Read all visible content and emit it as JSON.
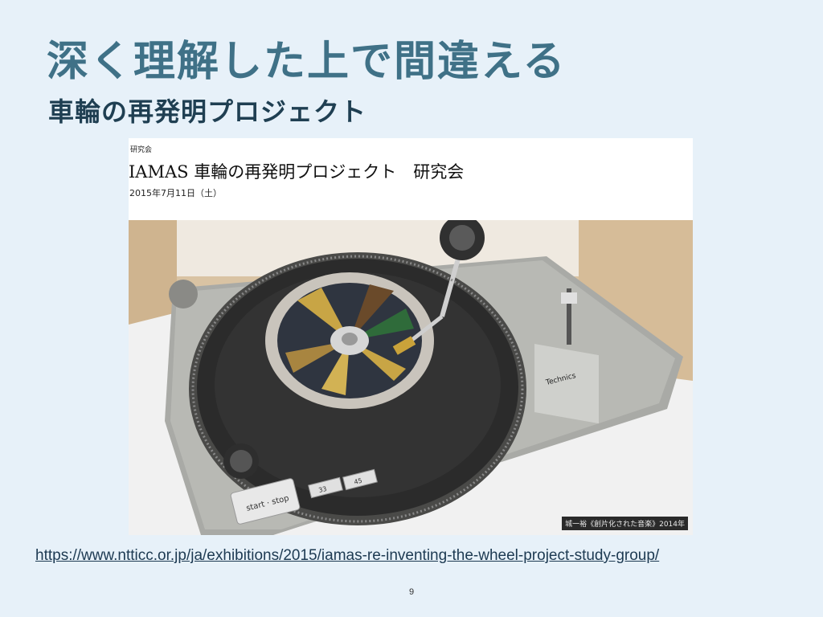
{
  "slide": {
    "title": "深く理解した上で間違える",
    "subtitle": "車輪の再発明プロジェクト",
    "url": "https://www.ntticc.or.jp/ja/exhibitions/2015/iamas-re-inventing-the-wheel-project-study-group/",
    "page_number": "9"
  },
  "card": {
    "category": "研究会",
    "title": "IAMAS 車輪の再発明プロジェクト　研究会",
    "date": "2015年7月11日（土）"
  },
  "photo": {
    "brand": "Technics",
    "start_stop_label": "start · stop",
    "speed_33": "33",
    "speed_45": "45",
    "caption": "城一裕《創片化された音楽》2014年"
  }
}
